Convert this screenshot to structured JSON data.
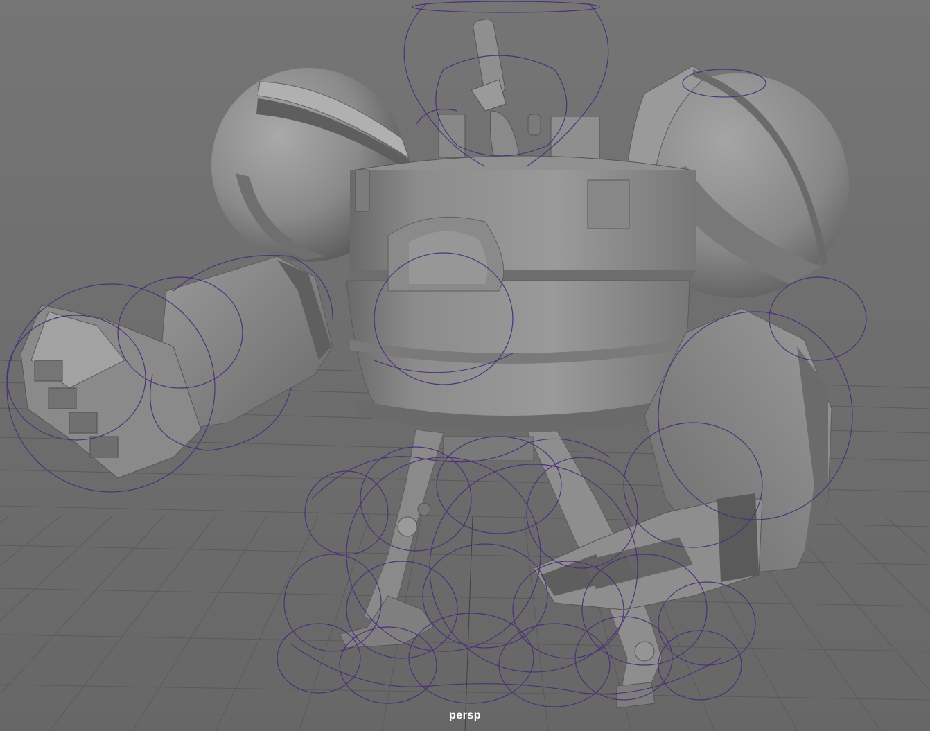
{
  "viewport": {
    "camera_label": "persp",
    "background_color": "#6e6e6e",
    "grid_color": "#5a5a5a",
    "grid_axis_color": "#3f3f3f",
    "mesh_color": "#8f8f8f",
    "mesh_shadow_color": "#5f5f5f",
    "rig_control_color": "#4b2e7a"
  }
}
